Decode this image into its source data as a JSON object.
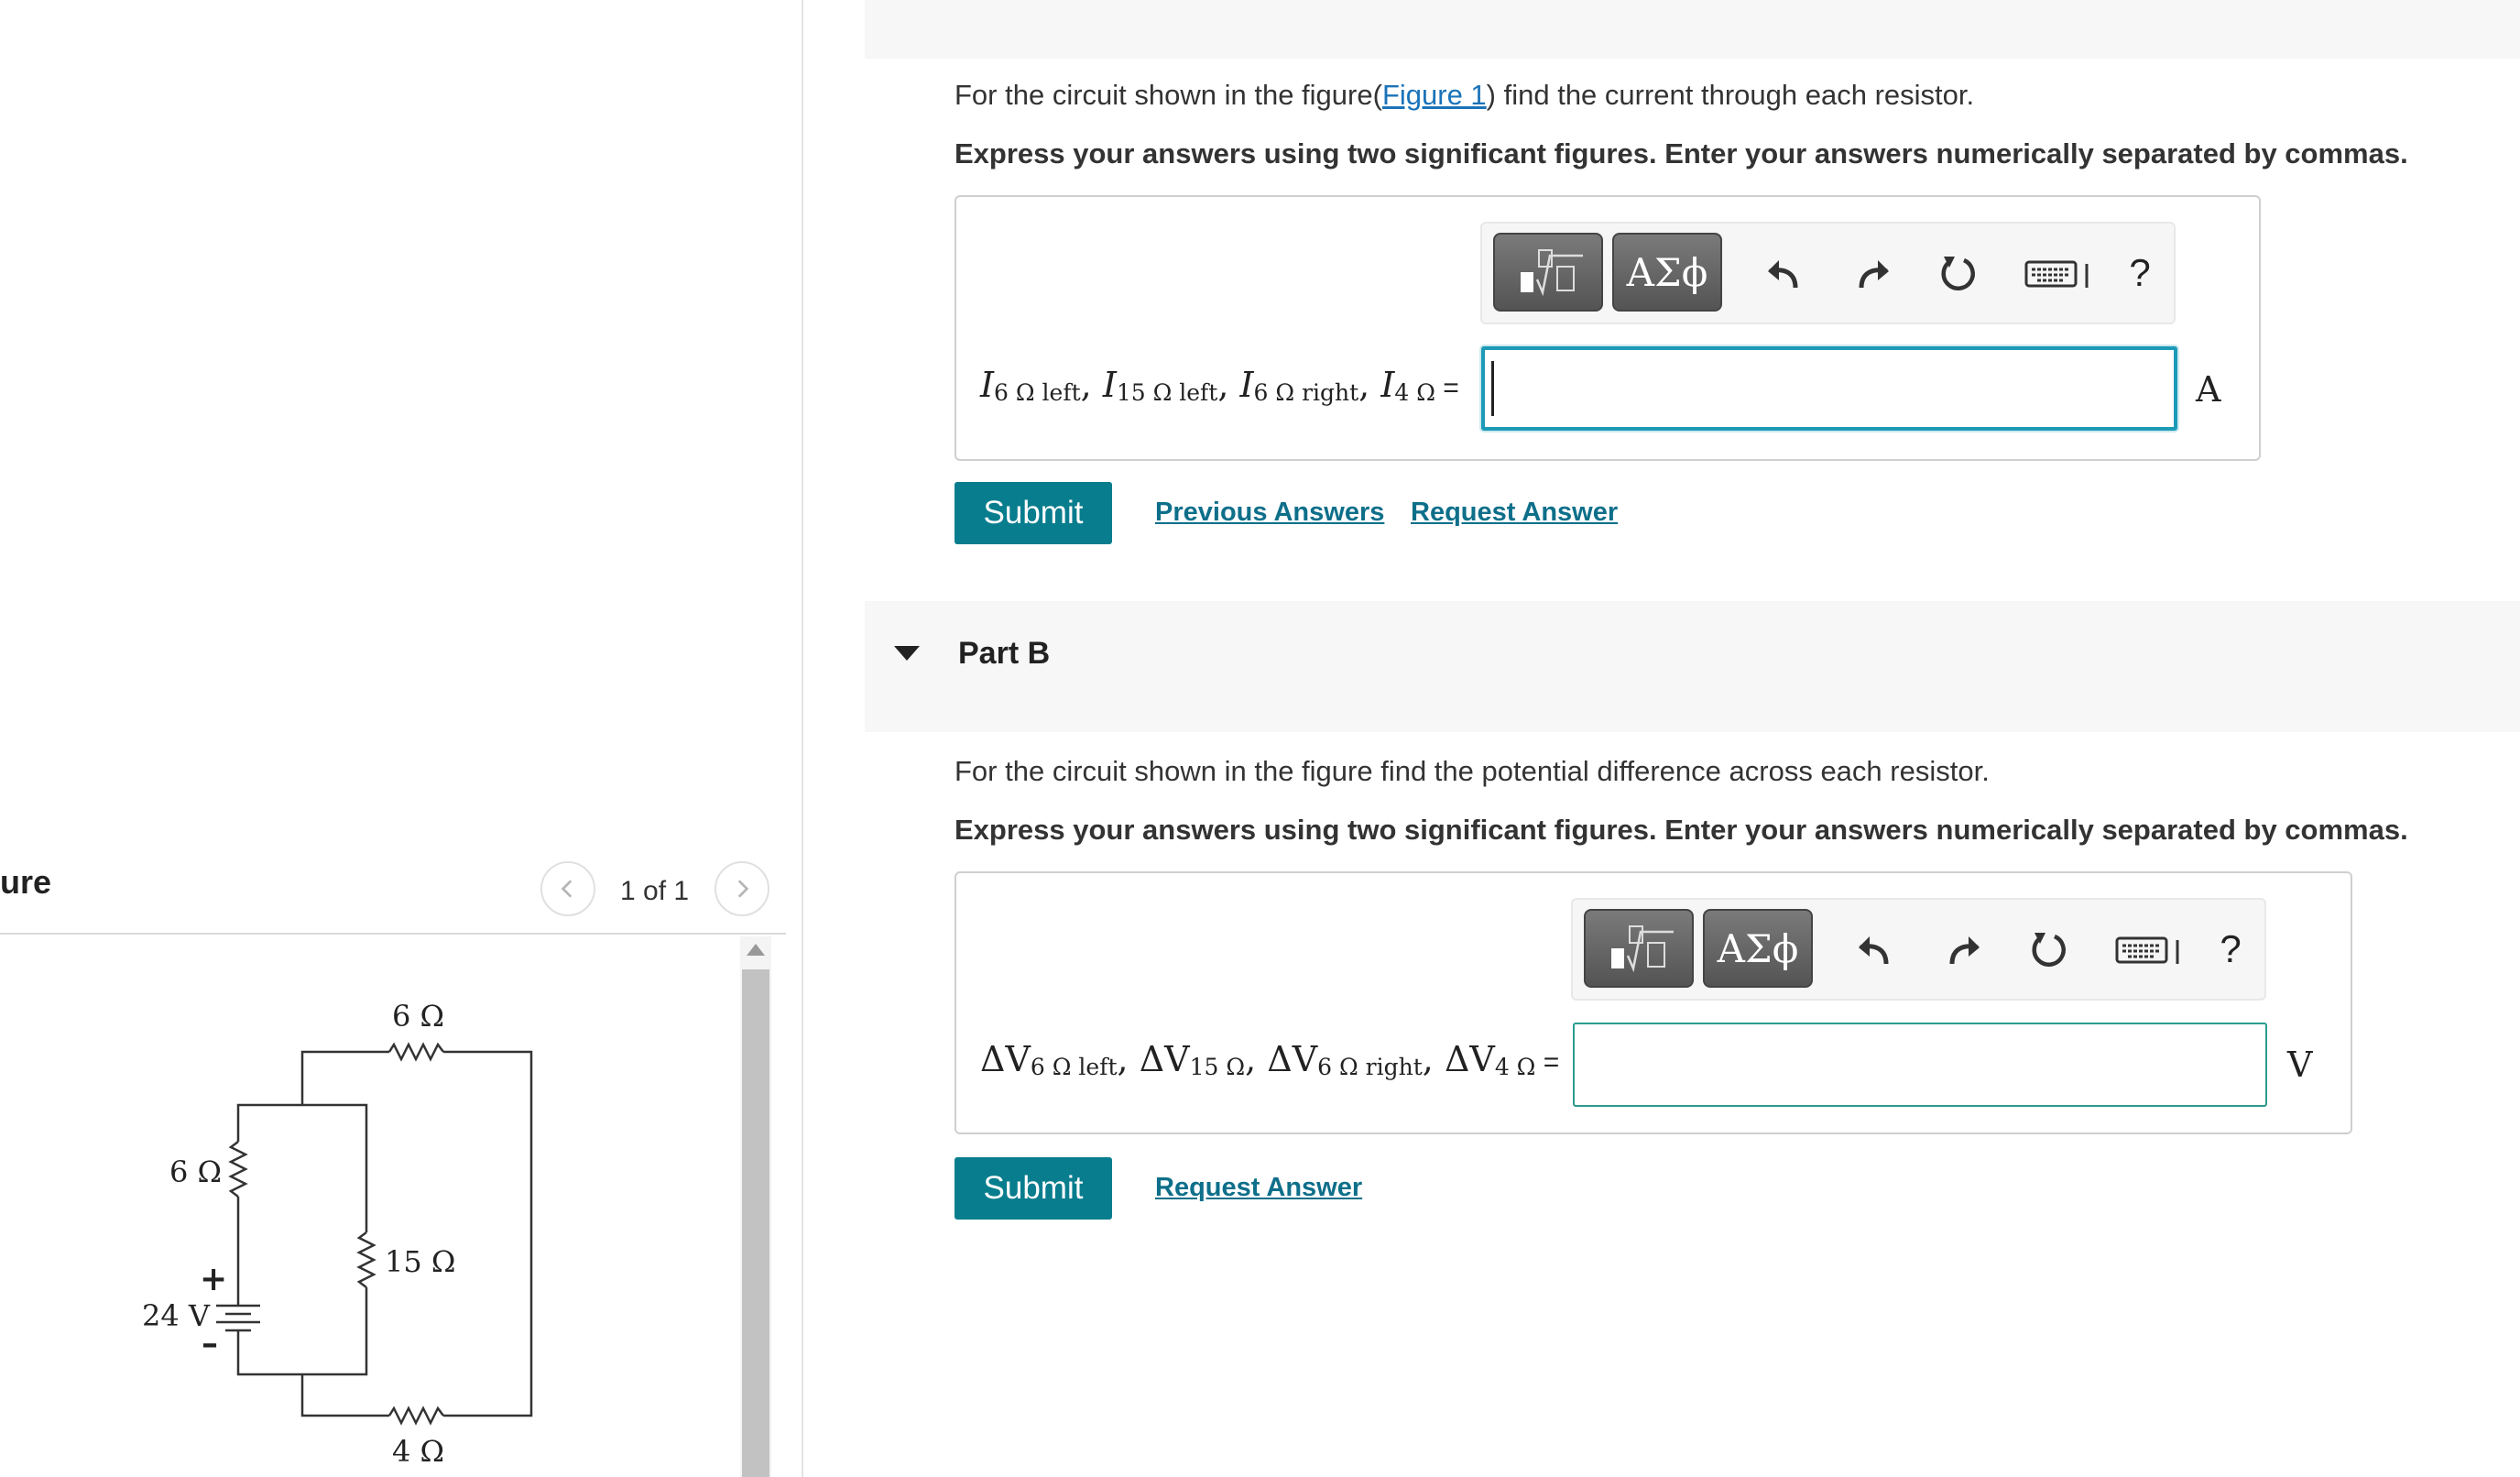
{
  "figure_panel": {
    "title": "ure",
    "pager": {
      "text": "1 of 1",
      "prev_icon": "chevron-left-icon",
      "next_icon": "chevron-right-icon"
    },
    "circuit": {
      "labels": {
        "r_top": "6 Ω",
        "r_left": "6 Ω",
        "r_middle": "15 Ω",
        "r_bottom": "4 Ω",
        "battery": "24 V",
        "plus": "+",
        "minus": "–"
      }
    }
  },
  "partA": {
    "prompt_before": "For the circuit shown in the figure(",
    "figure_link": "Figure 1",
    "prompt_after": ") find the current through each resistor.",
    "instruction": "Express your answers using two significant figures. Enter your answers numerically separated by commas.",
    "toolbar": {
      "templates_icon": "templates-icon",
      "symbols_label": "ΑΣϕ",
      "undo_icon": "undo-icon",
      "redo_icon": "redo-icon",
      "reset_icon": "reset-icon",
      "keyboard_icon": "keyboard-icon",
      "help_label": "?"
    },
    "label": {
      "v1": "I",
      "s1": "6 Ω left",
      "v2": "I",
      "s2": "15 Ω left",
      "v3": "I",
      "s3": "6 Ω right",
      "v4": "I",
      "s4": "4 Ω",
      "sep": ", ",
      "eq": " ="
    },
    "input_value": "",
    "unit": "A",
    "submit_label": "Submit",
    "previous_answers_label": "Previous Answers",
    "request_answer_label": "Request Answer"
  },
  "partB": {
    "title": "Part B",
    "prompt": "For the circuit shown in the figure find the potential difference across each resistor.",
    "instruction": "Express your answers using two significant figures. Enter your answers numerically separated by commas.",
    "toolbar": {
      "templates_icon": "templates-icon",
      "symbols_label": "ΑΣϕ",
      "undo_icon": "undo-icon",
      "redo_icon": "redo-icon",
      "reset_icon": "reset-icon",
      "keyboard_icon": "keyboard-icon",
      "help_label": "?"
    },
    "label": {
      "v1": "ΔV",
      "s1": "6 Ω left",
      "v2": "ΔV",
      "s2": "15 Ω",
      "v3": "ΔV",
      "s3": "6 Ω right",
      "v4": "ΔV",
      "s4": "4 Ω",
      "sep": ", ",
      "eq": " ="
    },
    "input_value": "",
    "unit": "V",
    "submit_label": "Submit",
    "request_answer_label": "Request Answer"
  },
  "colors": {
    "submit_bg": "#087d8e",
    "link": "#0e6f8a",
    "input_border_active": "#1d9ab7",
    "input_border": "#2a9c8e",
    "header_bg": "#f7f7f7"
  }
}
